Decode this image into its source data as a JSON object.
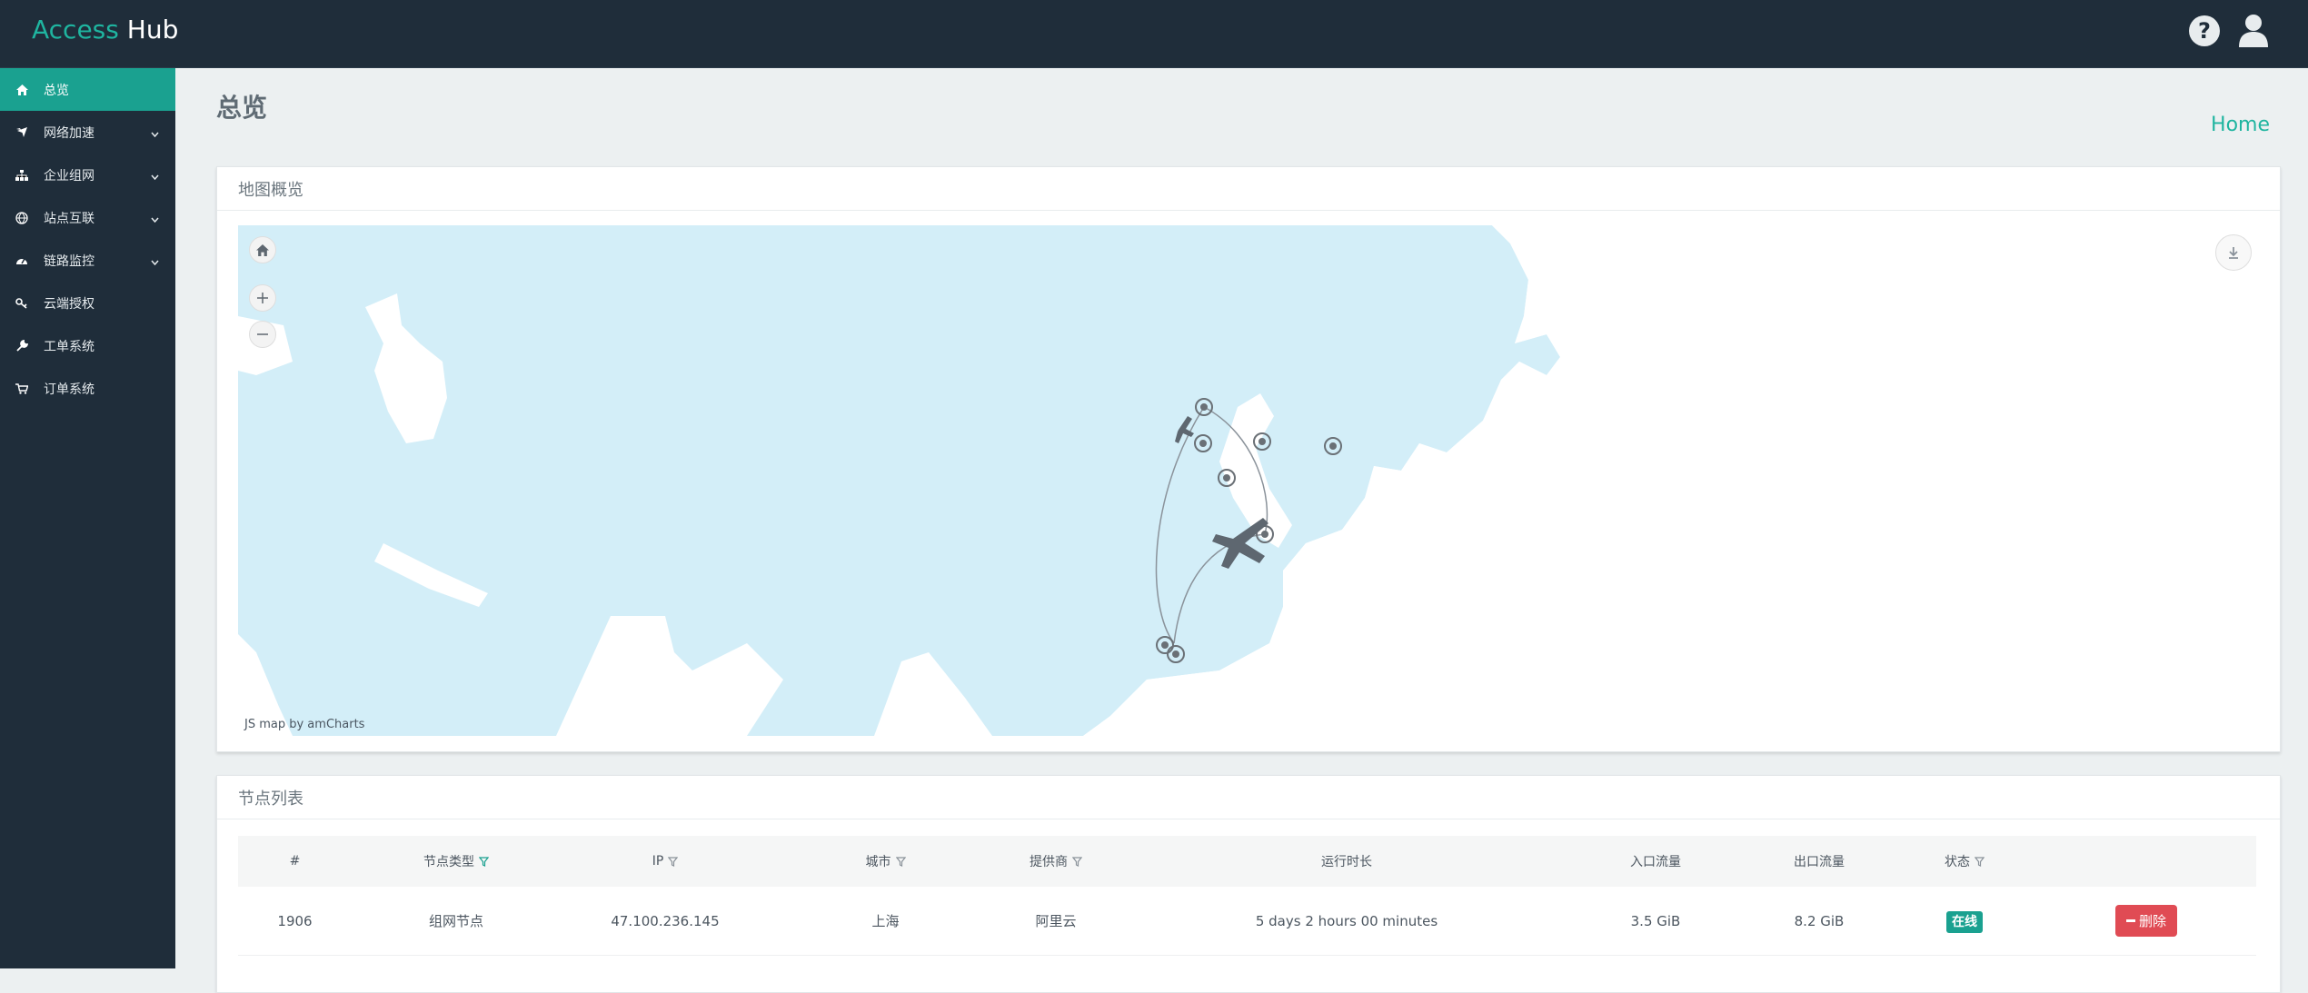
{
  "app": {
    "brand_part1": "Access",
    "brand_part2": "Hub",
    "accent_color": "#1fb5a0",
    "topbar_color": "#1f2d3a"
  },
  "topbar": {
    "icons": [
      "question-circle-icon",
      "user-icon"
    ]
  },
  "sidebar": {
    "items": [
      {
        "label": "总览",
        "icon": "home-icon",
        "active": true,
        "has_children": false
      },
      {
        "label": "网络加速",
        "icon": "plane-icon",
        "active": false,
        "has_children": true
      },
      {
        "label": "企业组网",
        "icon": "sitemap-icon",
        "active": false,
        "has_children": true
      },
      {
        "label": "站点互联",
        "icon": "globe-icon",
        "active": false,
        "has_children": true
      },
      {
        "label": "链路监控",
        "icon": "dashboard-icon",
        "active": false,
        "has_children": true
      },
      {
        "label": "云端授权",
        "icon": "key-icon",
        "active": false,
        "has_children": false
      },
      {
        "label": "工单系统",
        "icon": "wrench-icon",
        "active": false,
        "has_children": false
      },
      {
        "label": "订单系统",
        "icon": "cart-icon",
        "active": false,
        "has_children": false
      }
    ]
  },
  "page": {
    "title": "总览",
    "breadcrumb": "Home"
  },
  "map_panel": {
    "title": "地图概览",
    "credit": "JS map by amCharts",
    "controls": [
      "home-icon",
      "zoom-in-icon",
      "zoom-out-icon",
      "download-icon"
    ]
  },
  "node_panel": {
    "title": "节点列表",
    "columns": [
      {
        "label": "#",
        "filter": false
      },
      {
        "label": "节点类型",
        "filter": true,
        "filter_active": true
      },
      {
        "label": "IP",
        "filter": true
      },
      {
        "label": "城市",
        "filter": true
      },
      {
        "label": "提供商",
        "filter": true
      },
      {
        "label": "运行时长",
        "filter": false
      },
      {
        "label": "入口流量",
        "filter": false
      },
      {
        "label": "出口流量",
        "filter": false
      },
      {
        "label": "状态",
        "filter": true
      },
      {
        "label": "",
        "filter": false
      }
    ],
    "rows": [
      {
        "id": "1906",
        "type": "组网节点",
        "ip": "47.100.236.145",
        "city": "上海",
        "provider": "阿里云",
        "uptime": "5 days 2 hours 00 minutes",
        "in_traffic": "3.5 GiB",
        "out_traffic": "8.2 GiB",
        "status": "在线",
        "action": "删除"
      }
    ]
  }
}
